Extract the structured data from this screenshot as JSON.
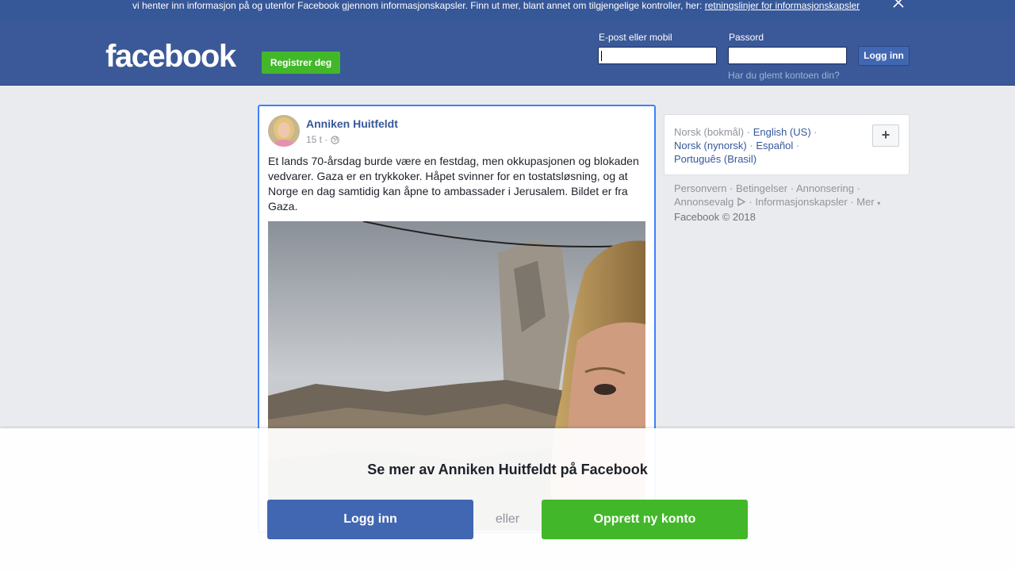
{
  "cookie_banner": {
    "text": "vi henter inn informasjon på og utenfor Facebook gjennom informasjonskapsler. Finn ut mer, blant annet om tilgjengelige kontroller, her: ",
    "link": "retningslinjer for informasjonskapsler"
  },
  "header": {
    "logo": "facebook",
    "register_label": "Registrer deg",
    "email_label": "E-post eller mobil",
    "password_label": "Passord",
    "login_label": "Logg inn",
    "forgot_link": "Har du glemt kontoen din?"
  },
  "post": {
    "author": "Anniken Huitfeldt",
    "time": "15 t ·",
    "text": "Et lands 70-årsdag burde være en festdag, men okkupasjonen og blokaden vedvarer. Gaza er en trykkoker. Håpet svinner for en tostatsløsning, og at Norge en dag samtidig kan åpne to ambassader i Jerusalem. Bildet er fra Gaza."
  },
  "languages": {
    "current": "Norsk (bokmål)",
    "others": [
      "English (US)",
      "Norsk (nynorsk)",
      "Español",
      "Português (Brasil)"
    ],
    "plus_label": "+"
  },
  "footer": {
    "links": [
      "Personvern",
      "Betingelser",
      "Annonsering",
      "Annonsevalg",
      "Informasjonskapsler",
      "Mer"
    ],
    "copyright": "Facebook © 2018"
  },
  "overlay": {
    "title": "Se mer av Anniken Huitfeldt på Facebook",
    "login_label": "Logg inn",
    "or_label": "eller",
    "create_label": "Opprett ny konto"
  },
  "colors": {
    "brand_blue": "#3b5998",
    "button_blue": "#4267b2",
    "green": "#42b72a",
    "link": "#365899"
  }
}
